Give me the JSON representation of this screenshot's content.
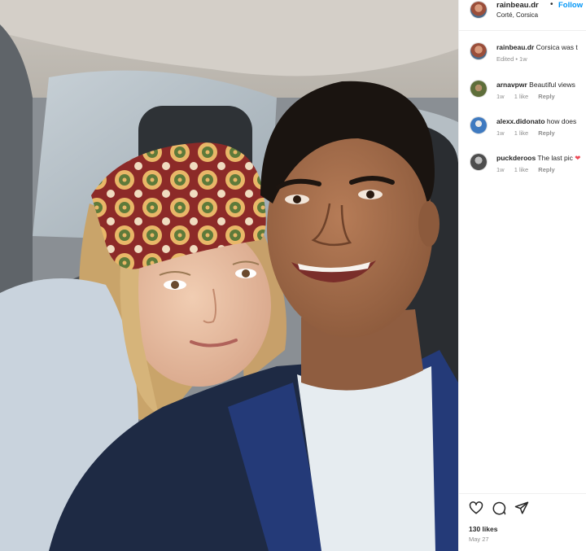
{
  "post": {
    "username": "rainbeau.dr",
    "separator": "•",
    "follow_label": "Follow",
    "location": "Corté, Corsica",
    "likes": "130 likes",
    "date": "May 27"
  },
  "comments": [
    {
      "username": "rainbeau.dr",
      "text": "Corsica was t",
      "meta": [
        "Edited • 1w"
      ],
      "avatar_color": "#b46a5a"
    },
    {
      "username": "arnavpwr",
      "text": "Beautiful views",
      "meta": [
        "1w",
        "1 like",
        "Reply"
      ],
      "avatar_color": "#7a8a52"
    },
    {
      "username": "alexx.didonato",
      "text": "how does",
      "meta": [
        "1w",
        "1 like",
        "Reply"
      ],
      "avatar_color": "#5b87b8"
    },
    {
      "username": "puckderoos",
      "text": "The last pic",
      "emoji": "❤",
      "meta": [
        "1w",
        "1 like",
        "Reply"
      ],
      "avatar_color": "#6b6b6b"
    }
  ],
  "icons": [
    "heart-icon",
    "comment-icon",
    "share-icon"
  ],
  "colors": {
    "accent": "#0095f6",
    "text": "#262626",
    "muted": "#8e8e8e",
    "heart_emoji": "#ed4956"
  }
}
